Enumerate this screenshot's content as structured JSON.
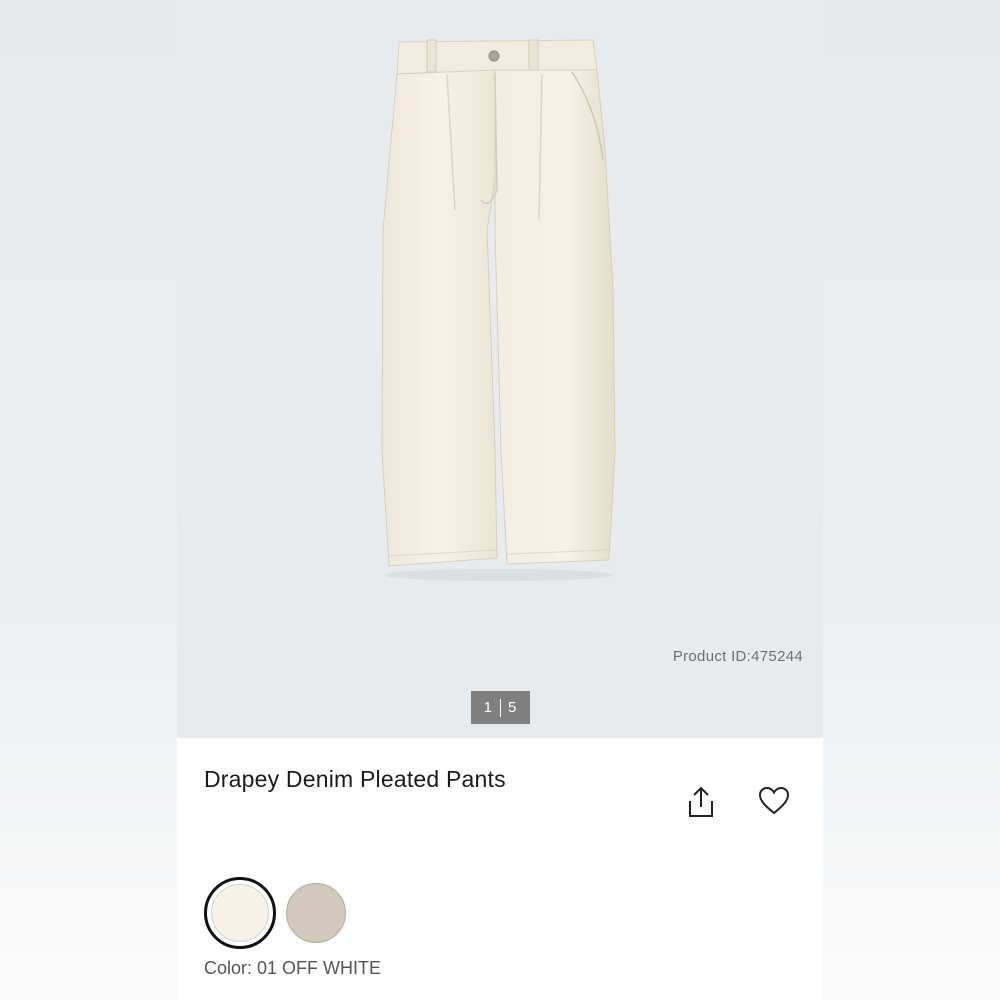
{
  "product": {
    "id_label": "Product ID:475244",
    "title": "Drapey Denim Pleated Pants",
    "color_label": "Color: 01 OFF WHITE"
  },
  "pager": {
    "current": "1",
    "total": "5"
  },
  "colors": {
    "selected_swatch": "#f6f2e7",
    "other_swatch": "#d2c9bd",
    "pants": "#f3efe2"
  },
  "icons": {
    "share": "share-icon",
    "favorite": "heart-icon"
  }
}
